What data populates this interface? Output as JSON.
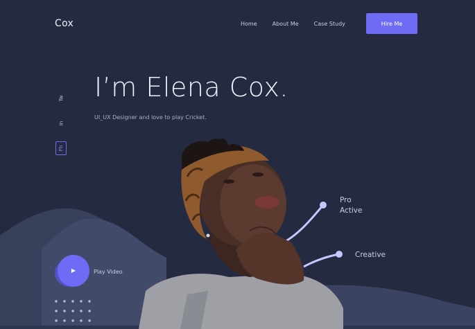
{
  "header": {
    "logo": "Cox",
    "nav": [
      {
        "label": "Home"
      },
      {
        "label": "About Me"
      },
      {
        "label": "Case Study"
      }
    ],
    "cta_label": "Hire Me"
  },
  "social": {
    "twitter": "Tw",
    "linkedin": "In",
    "facebook": "Fb"
  },
  "hero": {
    "title": "I’m Elena Cox.",
    "subtitle": "UI_UX Designer and love to play Cricket."
  },
  "callouts": {
    "pro_line1": "Pro",
    "pro_line2": "Active",
    "creative": "Creative"
  },
  "video": {
    "play_icon": "▶",
    "label": "Play Video"
  },
  "colors": {
    "background": "#242a40",
    "accent": "#6e6cf5",
    "hill": "#3a4260"
  }
}
